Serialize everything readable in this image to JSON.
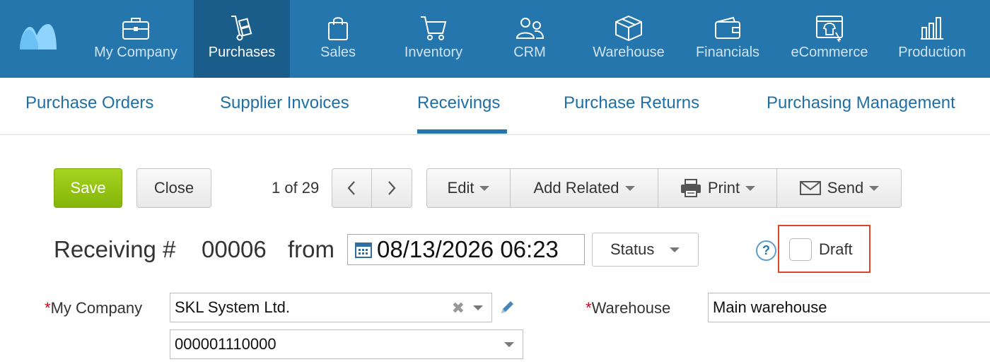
{
  "topnav": {
    "items": [
      {
        "label": "My Company",
        "icon": "briefcase-icon"
      },
      {
        "label": "Purchases",
        "icon": "hand-truck-icon",
        "active": true
      },
      {
        "label": "Sales",
        "icon": "shopping-bag-icon"
      },
      {
        "label": "Inventory",
        "icon": "cart-icon"
      },
      {
        "label": "CRM",
        "icon": "people-icon"
      },
      {
        "label": "Warehouse",
        "icon": "box-icon"
      },
      {
        "label": "Financials",
        "icon": "wallet-icon"
      },
      {
        "label": "eCommerce",
        "icon": "shop-shirt-icon"
      },
      {
        "label": "Production",
        "icon": "factory-icon"
      }
    ],
    "colors": {
      "bar": "#2476ad",
      "active": "#1a5d8a"
    }
  },
  "subnav": {
    "tabs": [
      {
        "label": "Purchase Orders"
      },
      {
        "label": "Supplier Invoices"
      },
      {
        "label": "Receivings",
        "active": true
      },
      {
        "label": "Purchase Returns"
      },
      {
        "label": "Purchasing Management"
      }
    ]
  },
  "toolbar": {
    "save_label": "Save",
    "close_label": "Close",
    "pager_text": "1 of 29",
    "edit_label": "Edit",
    "add_related_label": "Add Related",
    "print_label": "Print",
    "send_label": "Send"
  },
  "document": {
    "title": "Receiving #",
    "number": "00006",
    "from_label": "from",
    "date_value": "08/13/2026 06:23",
    "status_label": "Status",
    "help_label": "?",
    "draft_label": "Draft",
    "draft_checked": false
  },
  "form": {
    "required_mark": "*",
    "my_company_label": "My Company",
    "my_company_value": "SKL System Ltd.",
    "my_company_account": "000001110000",
    "warehouse_label": "Warehouse",
    "warehouse_value": "Main warehouse"
  }
}
